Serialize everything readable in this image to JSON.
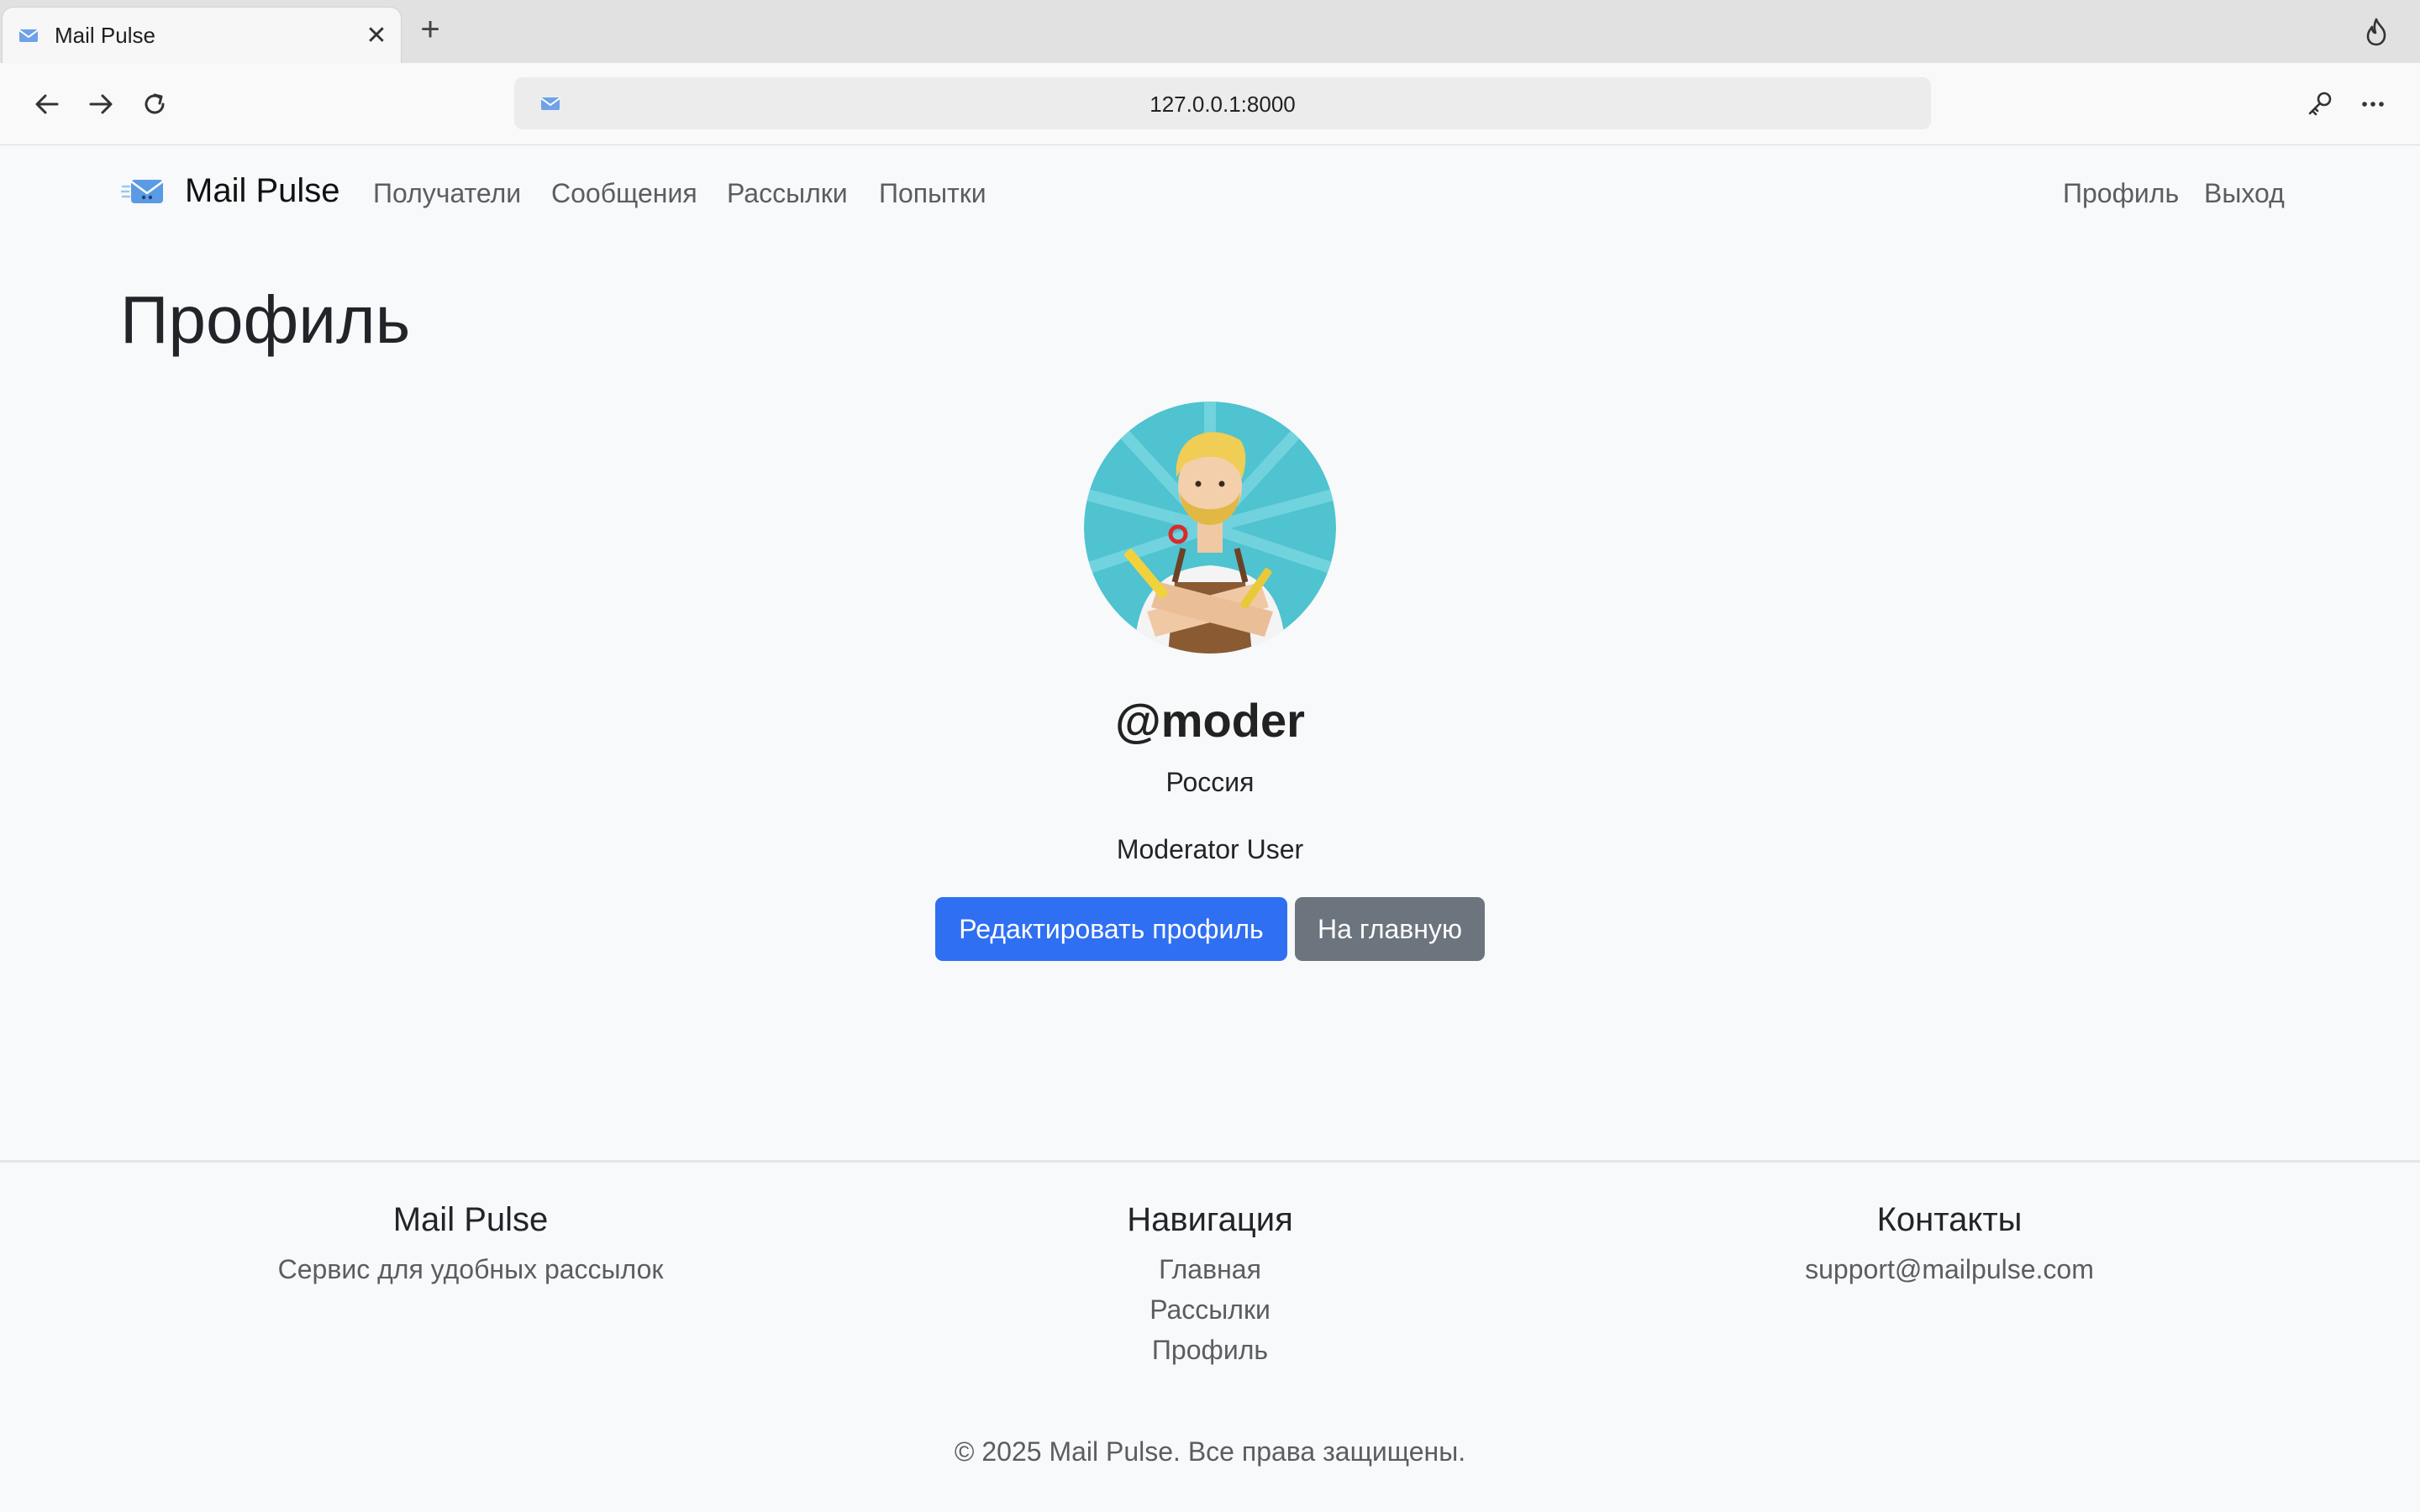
{
  "browser": {
    "tab_title": "Mail Pulse",
    "url": "127.0.0.1:8000"
  },
  "navbar": {
    "brand": "Mail Pulse",
    "links": [
      "Получатели",
      "Сообщения",
      "Рассылки",
      "Попытки"
    ],
    "right_links": [
      "Профиль",
      "Выход"
    ]
  },
  "page": {
    "title": "Профиль"
  },
  "profile": {
    "username": "@moder",
    "country": "Россия",
    "full_name": "Moderator User",
    "edit_button": "Редактировать профиль",
    "home_button": "На главную"
  },
  "footer": {
    "about_title": "Mail Pulse",
    "about_text": "Сервис для удобных рассылок",
    "nav_title": "Навигация",
    "nav_links": [
      "Главная",
      "Рассылки",
      "Профиль"
    ],
    "contacts_title": "Контакты",
    "email": "support@mailpulse.com",
    "copyright": "© 2025 Mail Pulse. Все права защищены."
  },
  "colors": {
    "primary": "#2f6ff2",
    "secondary": "#6c757d",
    "avatar_bg": "#4fc3d0"
  }
}
